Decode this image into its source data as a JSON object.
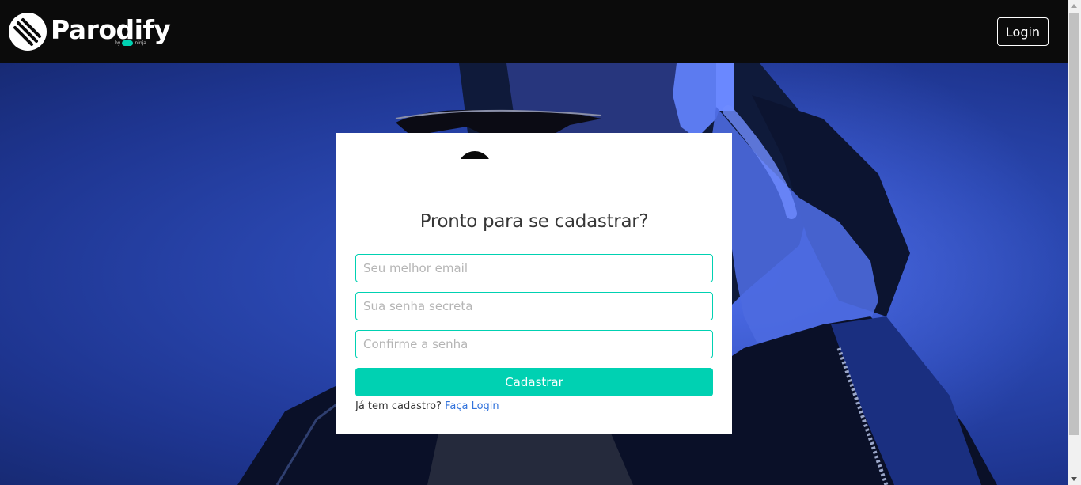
{
  "navbar": {
    "brand_name": "Parodify",
    "brand_by": "by",
    "brand_partner": "ninja",
    "login_label": "Login",
    "logo_icon": "parodify-logo-icon"
  },
  "signup": {
    "title": "Pronto para se cadastrar?",
    "email_placeholder": "Seu melhor email",
    "password_placeholder": "Sua senha secreta",
    "confirm_placeholder": "Confirme a senha",
    "submit_label": "Cadastrar",
    "have_account_text": "Já tem cadastro?",
    "login_link_label": "Faça Login"
  },
  "colors": {
    "accent": "#00d1b2",
    "navbar_bg": "#0b0b0b",
    "link": "#3273dc",
    "hero_blue": "#2a47b0"
  }
}
